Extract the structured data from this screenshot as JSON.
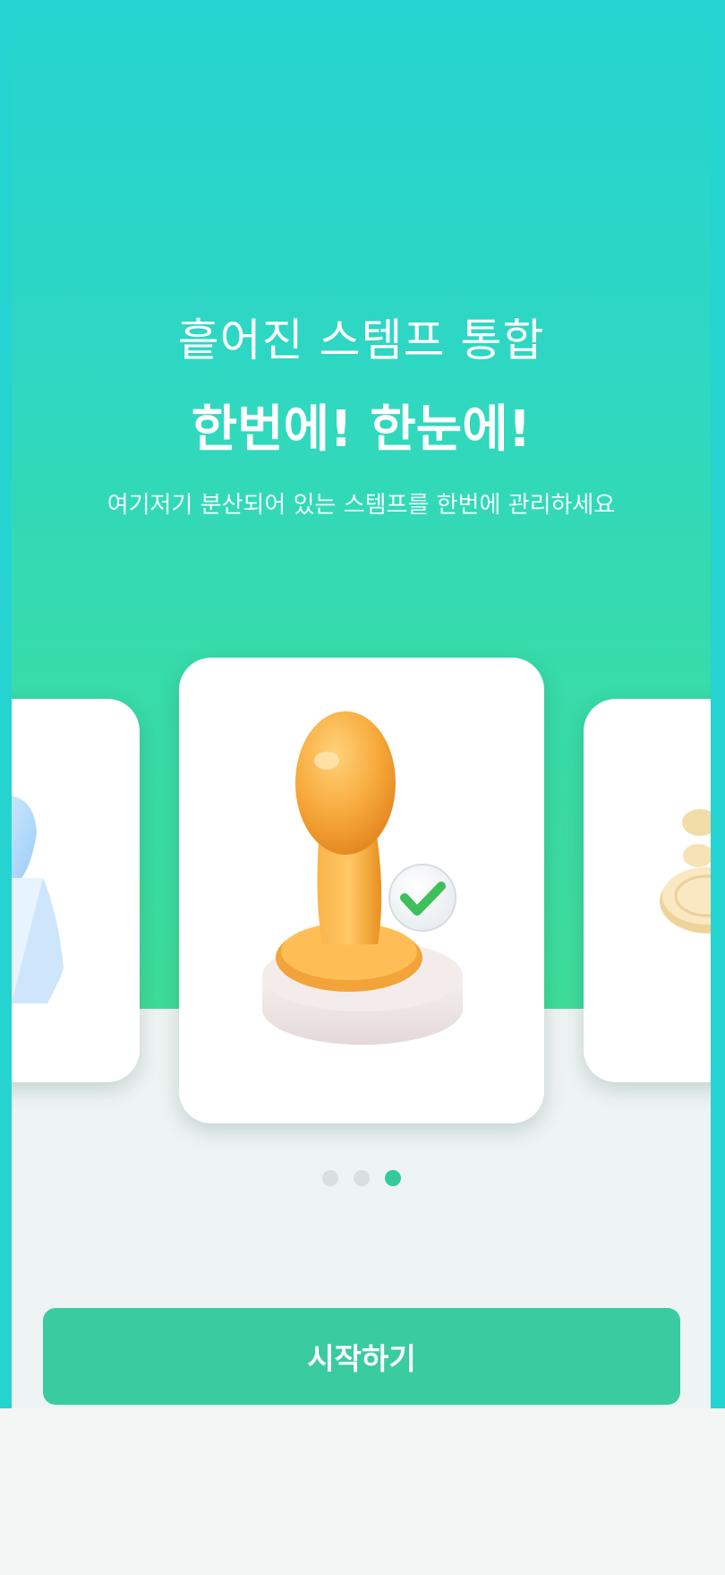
{
  "onboarding": {
    "title_line1": "흩어진 스템프 통합",
    "title_line2": "한번에! 한눈에!",
    "subtitle": "여기저기 분산되어 있는 스템프를 한번에 관리하세요"
  },
  "carousel": {
    "cards": [
      {
        "icon": "blue-stamp-icon"
      },
      {
        "icon": "orange-stamp-check-icon"
      },
      {
        "icon": "gold-coins-icon"
      }
    ],
    "page_count": 3,
    "active_page": 3
  },
  "footer": {
    "start_label": "시작하기"
  },
  "colors": {
    "hero_top": "#25d4d0",
    "hero_bottom": "#3fdc9a",
    "button": "#3acba1",
    "dot_active": "#35c99b",
    "dot_inactive": "#d9dedf"
  }
}
